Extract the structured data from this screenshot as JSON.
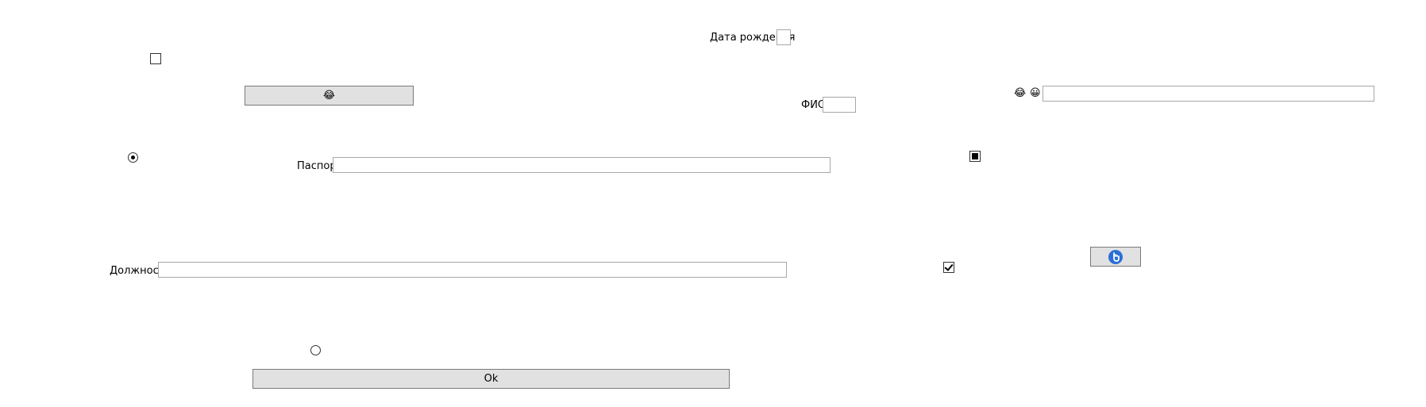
{
  "fields": {
    "dob": {
      "label": "Дата рождения",
      "value": ""
    },
    "fio": {
      "label": "ФИО",
      "value": ""
    },
    "passport": {
      "label": "Паспорт",
      "value": ""
    },
    "position": {
      "label": "Должность",
      "value": ""
    },
    "emoji_field": {
      "value": ""
    }
  },
  "buttons": {
    "top_emoji_button": {
      "label": "😂"
    },
    "ok_button": {
      "label": "Ok"
    }
  },
  "emoji_labels": [
    "😂",
    "😀"
  ],
  "controls": {
    "checkbox_top_left": {
      "state": "unchecked"
    },
    "checkbox_right_middle": {
      "state": "indeterminate"
    },
    "checkbox_right_lower": {
      "state": "checked"
    },
    "radio_left": {
      "state": "checked"
    },
    "radio_bottom": {
      "state": "unchecked"
    }
  },
  "icons": {
    "image_button_icon": "click-hand-icon"
  },
  "colors": {
    "icon_blue": "#2a6fd6",
    "button_bg": "#e1e1e1",
    "border": "#a8a8a8"
  }
}
